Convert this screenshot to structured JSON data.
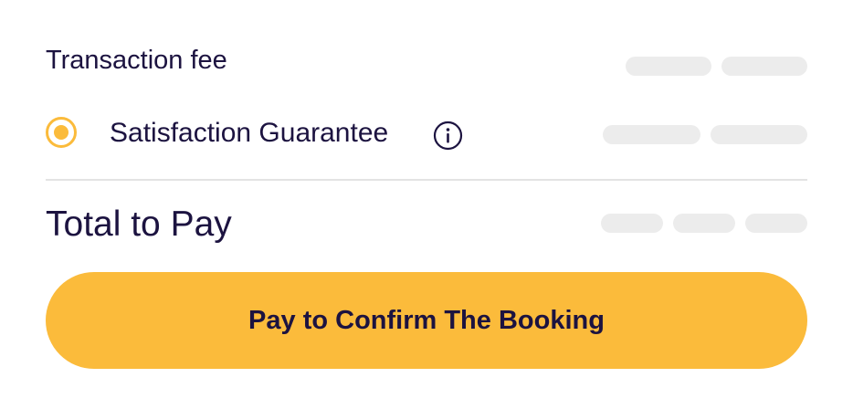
{
  "summary": {
    "transaction_fee_label": "Transaction fee",
    "guarantee_label": "Satisfaction Guarantee",
    "guarantee_selected": true,
    "total_label": "Total to Pay"
  },
  "cta": {
    "pay_label": "Pay to Confirm The Booking"
  },
  "icons": {
    "guarantee_info": "info-icon",
    "guarantee_radio": "radio-selected-icon"
  },
  "colors": {
    "accent": "#fbbb3b",
    "text": "#1c1340",
    "skeleton": "#ececec",
    "divider": "#e3e3e3"
  }
}
